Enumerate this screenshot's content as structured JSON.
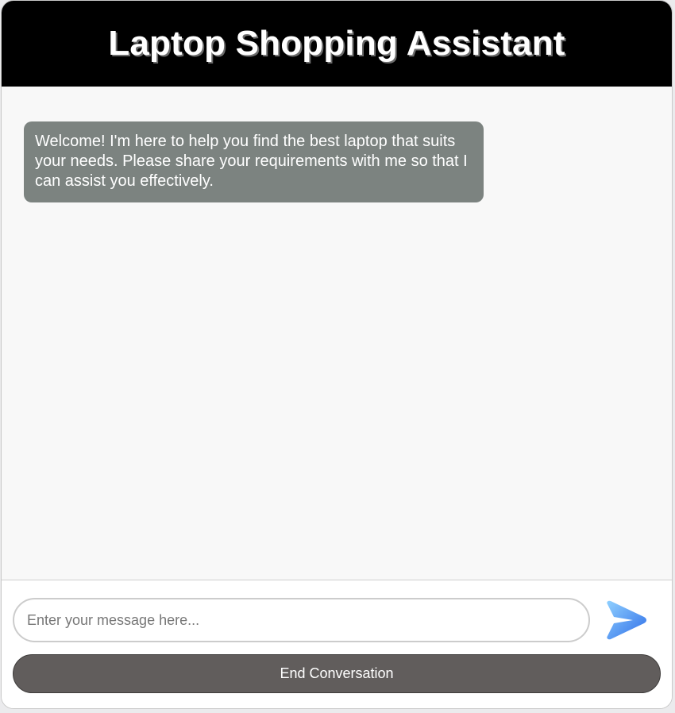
{
  "header": {
    "title": "Laptop Shopping Assistant"
  },
  "chat": {
    "messages": [
      {
        "role": "assistant",
        "text": "Welcome! I'm here to help you find the best laptop that suits your needs. Please share your requirements with me so that I can assist you effectively."
      }
    ]
  },
  "composer": {
    "input_placeholder": "Enter your message here...",
    "input_value": "",
    "send_icon": "send-arrow-icon",
    "end_button_label": "End Conversation"
  },
  "colors": {
    "header_bg": "#000000",
    "bubble_bg": "#7c8380",
    "end_button_bg": "#615d5c",
    "send_icon_gradient": [
      "#8fd0ff",
      "#2f6ee8"
    ]
  }
}
